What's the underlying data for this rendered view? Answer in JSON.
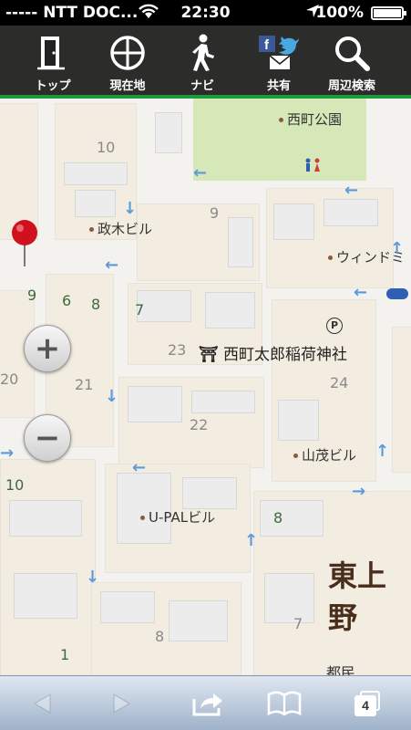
{
  "status": {
    "carrier": "----- NTT DOC...",
    "time": "22:30",
    "battery": "100%"
  },
  "nav": {
    "items": [
      {
        "label": "トップ",
        "icon": "door-icon"
      },
      {
        "label": "現在地",
        "icon": "crosshair-icon"
      },
      {
        "label": "ナビ",
        "icon": "walker-icon"
      },
      {
        "label": "共有",
        "icon": "share-icon"
      },
      {
        "label": "周辺検索",
        "icon": "search-icon"
      }
    ]
  },
  "map": {
    "places": {
      "park": "西町公園",
      "masaki": "政木ビル",
      "window": "ウィンドミ",
      "shrine": "西町太郎稲荷神社",
      "yamashige": "山茂ビル",
      "upal": "U-PALビル",
      "higashiueno": "東上野",
      "bottom": "都民"
    },
    "block_numbers": {
      "n10a": "10",
      "n9a": "9",
      "n9b": "9",
      "n6": "6",
      "n8a": "8",
      "n7a": "7",
      "n23": "23",
      "n24": "24",
      "n20": "20",
      "n21": "21",
      "n22": "22",
      "n10b": "10",
      "n8b": "8",
      "n8c": "8",
      "n7b": "7",
      "n1": "1"
    },
    "shrine_symbol": "⛩",
    "parking_symbol": "P"
  },
  "zoom": {
    "in": "+",
    "out": "−"
  },
  "toolbar": {
    "tabs_count": "4"
  },
  "colors": {
    "accent_green": "#1a9b3c",
    "road_arrow": "#5b9bd9"
  }
}
